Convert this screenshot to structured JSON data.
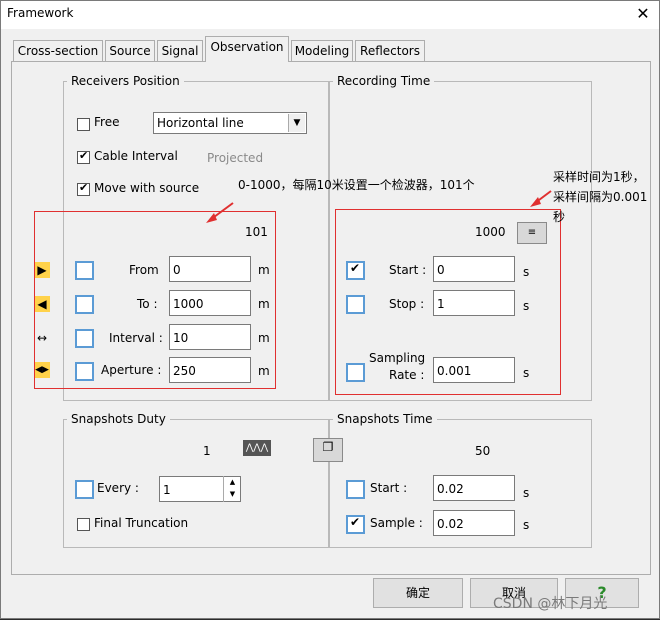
{
  "window": {
    "title": "Framework",
    "close": "✕"
  },
  "tabs": [
    "Cross-section",
    "Source",
    "Signal",
    "Observation",
    "Modeling",
    "Reflectors"
  ],
  "receivers": {
    "title": "Receivers Position",
    "free_label": "Free",
    "layout_value": "Horizontal line",
    "cable_label": "Cable Interval",
    "projected_label": "Projected",
    "move_label": "Move with source",
    "count": "101",
    "from_label": "From",
    "from_value": "0",
    "to_label": "To :",
    "to_value": "1000",
    "interval_label": "Interval :",
    "interval_value": "10",
    "aperture_label": "Aperture :",
    "aperture_value": "250",
    "unit": "m"
  },
  "recording": {
    "title": "Recording Time",
    "count": "1000",
    "start_label": "Start :",
    "start_value": "0",
    "stop_label": "Stop :",
    "stop_value": "1",
    "sampling_label1": "Sampling",
    "sampling_label2": "Rate :",
    "rate_value": "0.001",
    "unit": "s"
  },
  "snap_duty": {
    "title": "Snapshots Duty",
    "count": "1",
    "every_label": "Every :",
    "every_value": "1",
    "final_label": "Final Truncation"
  },
  "snap_time": {
    "title": "Snapshots Time",
    "count": "50",
    "start_label": "Start :",
    "start_value": "0.02",
    "sample_label": "Sample :",
    "sample_value": "0.02",
    "unit": "s"
  },
  "annotations": {
    "left": "0-1000，每隔10米设置一个检波器，101个",
    "right1": "采样时间为1秒，",
    "right2": "采样间隔为0.001",
    "right3": "秒"
  },
  "buttons": {
    "ok": "确定",
    "cancel": "取消",
    "help": "?"
  },
  "watermark": "CSDN @林下月光",
  "colors": {
    "annotation_red": "#e03030",
    "checkbox_blue": "#5b9bd5"
  }
}
